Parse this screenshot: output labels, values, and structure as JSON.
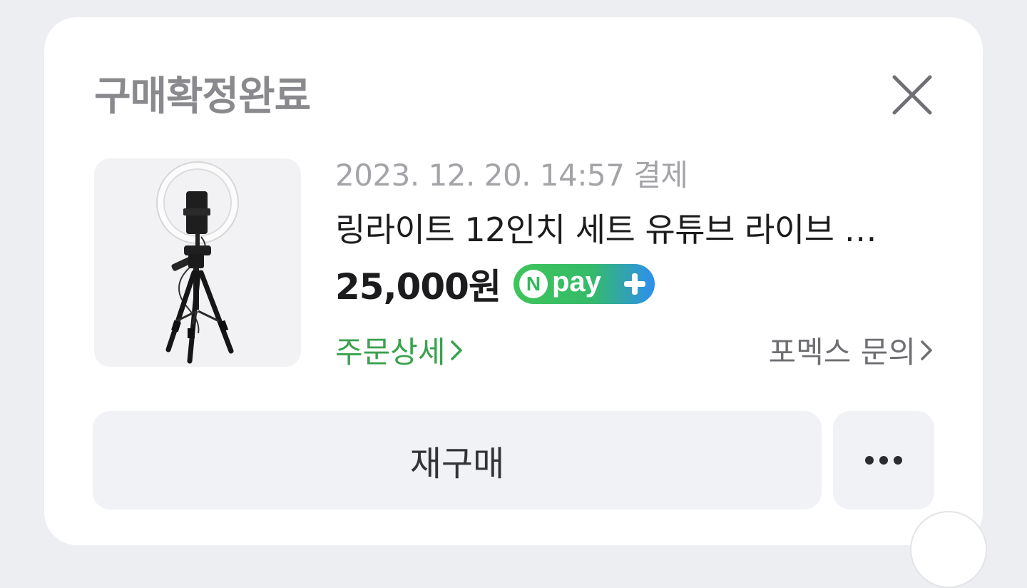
{
  "modal": {
    "title": "구매확정완료",
    "close_icon": "close-icon"
  },
  "order": {
    "payment_date": "2023. 12. 20. 14:57 결제",
    "product_name": "링라이트 12인치 세트 유튜브 라이브 …",
    "price": "25,000원",
    "badge": {
      "n": "N",
      "text": "pay",
      "plus_icon": "plus-icon"
    },
    "order_detail_link": "주문상세",
    "seller_inquiry_link": "포멕스 문의",
    "thumbnail_icon": "ring-light-tripod-image"
  },
  "actions": {
    "rebuy_label": "재구매",
    "more_icon": "more-dots-icon"
  },
  "colors": {
    "background": "#eceef2",
    "card": "#ffffff",
    "title": "#8a8a8e",
    "green_link": "#3aa14e",
    "button_bg": "#f1f2f5",
    "npay_green": "#3fc45a",
    "npay_blue": "#2f8ef0"
  }
}
